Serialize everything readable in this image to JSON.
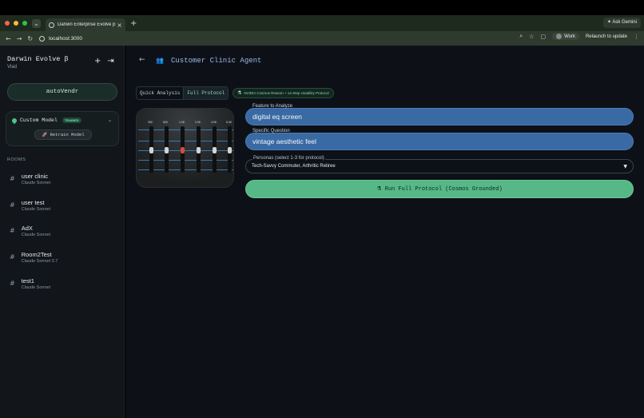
{
  "browser": {
    "tab_title": "Darwin Enterprise Evolve β",
    "tab_close": "×",
    "new_tab": "+",
    "ask_gemini": "Ask Gemini",
    "url": "localhost:3000",
    "profile": "Work",
    "relaunch": "Relaunch to update",
    "colors": {
      "close": "#ff5f57",
      "min": "#febc2e",
      "max": "#28c840"
    }
  },
  "sidebar": {
    "brand": "Darwin Evolve β",
    "user": "Vlad",
    "add_icon": "+",
    "logout_icon": "⇥",
    "auto_button": "autoVendr",
    "model": {
      "name": "Custom Model",
      "badge": "TRAINED",
      "retrain": "Retrain Model"
    },
    "rooms_label": "ROOMS",
    "rooms": [
      {
        "name": "user clinic",
        "model": "Claude Sonnet"
      },
      {
        "name": "user test",
        "model": "Claude Sonnet"
      },
      {
        "name": "AdX",
        "model": "Claude Sonnet"
      },
      {
        "name": "Room2Test",
        "model": "Claude Sonnet 3.7"
      },
      {
        "name": "test1",
        "model": "Claude Sonnet"
      }
    ]
  },
  "main": {
    "title": "Customer Clinic Agent",
    "modes": [
      "Quick Analysis",
      "Full Protocol"
    ],
    "active_mode": "Full Protocol",
    "protocol_badge": "NVIDIA Cosmos Reason + 14-Step Usability Protocol",
    "eq_image": {
      "frequencies": [
        "250",
        "500",
        "1.0K",
        "2.0K",
        "4.0K",
        "8.0K"
      ]
    },
    "feature": {
      "label": "Feature to Analyze",
      "value": "digital eq screen"
    },
    "question": {
      "label": "Specific Question",
      "value": "vintage aesthetic feel"
    },
    "personas": {
      "label": "Personas (select 1-3 for protocol)",
      "value": "Tech-Savvy Commuter, Arthritic Retiree"
    },
    "run_button": "Run Full Protocol (Cosmos Grounded)"
  }
}
